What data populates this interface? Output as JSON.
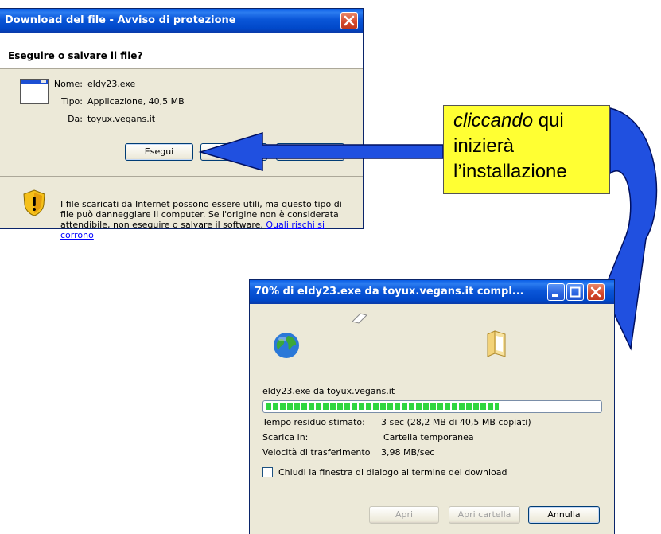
{
  "dialog1": {
    "title": "Download del file - Avviso di protezione",
    "question": "Eseguire o salvare il file?",
    "name_label": "Nome:",
    "name_value": "eldy23.exe",
    "type_label": "Tipo:",
    "type_value": "Applicazione, 40,5 MB",
    "from_label": "Da:",
    "from_value": "toyux.vegans.it",
    "run_button": "Esegui",
    "warning_text": "I file scaricati da Internet possono essere utili, ma questo tipo di file può danneggiare il computer. Se l'origine non è considerata attendibile, non eseguire o salvare il software. ",
    "risk_link": "Quali rischi si corrono"
  },
  "annotation": {
    "italic_part": "cliccando",
    "line1_rest": " qui",
    "line2": "inizierà",
    "line3": "l’installazione",
    "color": "#ffff33"
  },
  "dialog2": {
    "title": "70% di eldy23.exe da toyux.vegans.it compl...",
    "file_source": "eldy23.exe da toyux.vegans.it",
    "progress_percent": 70,
    "time_label": "Tempo residuo stimato:",
    "time_value": "3 sec (28,2 MB di 40,5 MB copiati)",
    "download_to_label": "Scarica in:",
    "download_to_value": "Cartella temporanea",
    "speed_label": "Velocità di trasferimento",
    "speed_value": "3,98 MB/sec",
    "close_checkbox_label": "Chiudi la finestra di dialogo al termine del download",
    "open_button": "Apri",
    "open_folder_button": "Apri cartella",
    "cancel_button": "Annulla"
  }
}
